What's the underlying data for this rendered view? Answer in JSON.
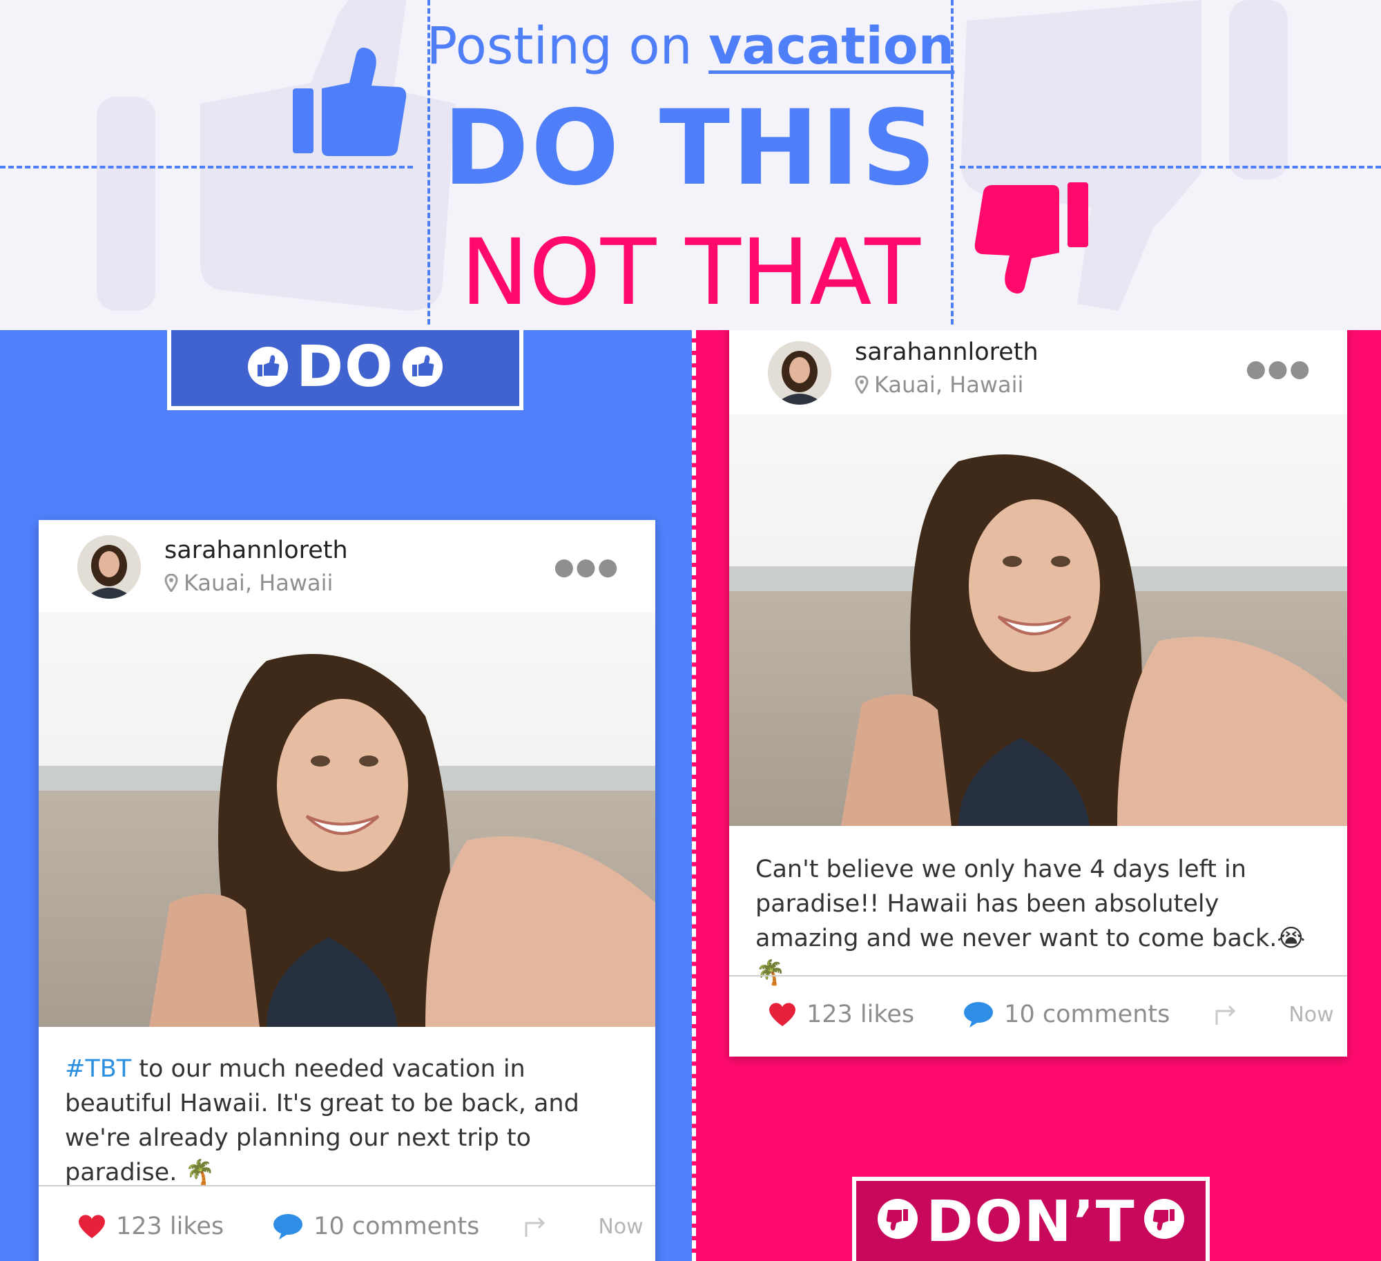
{
  "header": {
    "kicker_prefix": "Posting on",
    "kicker_emphasis": "vacation",
    "title_do": "DO THIS",
    "title_not": "NOT THAT"
  },
  "colors": {
    "blue": "#4f7ff8",
    "pink": "#ff0a6c",
    "panel_blue": "#5081fb",
    "panel_pink": "#ff0b6e"
  },
  "do_panel": {
    "badge_label": "DO",
    "badge_icon": "thumbs-up-icon",
    "post": {
      "username": "sarahannloreth",
      "location": "Kauai, Hawaii",
      "hashtag": "#TBT",
      "caption": "to our much needed vacation in beautiful Hawaii. It's great to be back, and we're already planning our next trip to paradise. 🌴",
      "likes": "123 likes",
      "comments": "10 comments",
      "time": "Now"
    }
  },
  "dont_panel": {
    "badge_label": "DON’T",
    "badge_icon": "thumbs-down-icon",
    "post": {
      "username": "sarahannloreth",
      "location": "Kauai, Hawaii",
      "caption": "Can't believe we only have 4 days left in paradise!! Hawaii has been absolutely amazing and we never want to come back.😭 🌴",
      "likes": "123 likes",
      "comments": "10 comments",
      "time": "Now"
    }
  }
}
